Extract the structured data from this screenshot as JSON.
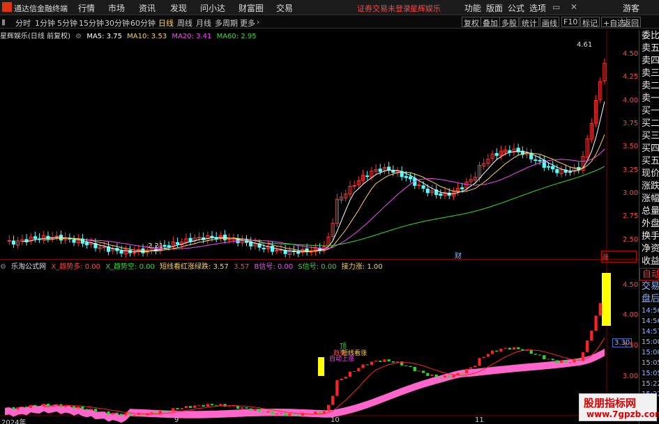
{
  "window": {
    "app_name": "通达信金融终端",
    "menus": [
      "行情",
      "市场",
      "资讯",
      "发现",
      "问小达",
      "财富圈",
      "交易"
    ],
    "notice": "证券交易未登录",
    "stock_title": "星辉娱乐",
    "right_menus": [
      "功能",
      "版面",
      "公式",
      "选项"
    ],
    "guest": "游客"
  },
  "toolbar": {
    "periods": [
      "分时",
      "1分钟",
      "5分钟",
      "15分钟",
      "30分钟",
      "60分钟",
      "日线",
      "周线",
      "月线",
      "多周期",
      "更多"
    ],
    "active_period": "日线",
    "right_buttons": [
      "复权",
      "叠加",
      "多股",
      "统计",
      "画线",
      "F10",
      "标记",
      "+自选",
      "返回"
    ]
  },
  "main_chart": {
    "stock_label": "星辉娱乐(日线 前复权)",
    "ma": [
      {
        "name": "MA5",
        "value": "3.75",
        "color": "#ffffff"
      },
      {
        "name": "MA10",
        "value": "3.53",
        "color": "#ffd34d"
      },
      {
        "name": "MA20",
        "value": "3.41",
        "color": "#ff44ff"
      },
      {
        "name": "MA60",
        "value": "2.95",
        "color": "#33dd33"
      }
    ],
    "price_ticks": [
      "4.50",
      "4.25",
      "4.00",
      "3.75",
      "3.50",
      "3.25",
      "3.00",
      "2.75",
      "2.50"
    ],
    "high_label": "4.61",
    "low_label": "2.21",
    "marks": [
      "财",
      "涨"
    ]
  },
  "indicator": {
    "label": "乐淘公式网",
    "items": [
      {
        "name": "X_趋势多",
        "value": "0.00",
        "color": "#ff4444"
      },
      {
        "name": "X_趋势空",
        "value": "0.00",
        "color": "#33dd33"
      },
      {
        "name": "短线看红涨绿跌",
        "value": "3.57",
        "color": "#ffd34d"
      },
      {
        "name": "",
        "value": "3.57",
        "color": "#ff4444"
      },
      {
        "name": "B信号",
        "value": "0.00",
        "color": "#ff44ff"
      },
      {
        "name": "S信号",
        "value": "0.00",
        "color": "#33dd33"
      },
      {
        "name": "接力涨",
        "value": "1.00",
        "color": "#ffd34d"
      }
    ],
    "price_ticks": [
      "4.50",
      "4.00",
      "3.50",
      "3.00"
    ],
    "current": "3.30",
    "annotations": [
      "顶",
      "趋势",
      "短线看涨",
      "自动上涨"
    ]
  },
  "right_panel": [
    "委比",
    "卖五",
    "卖四",
    "卖三",
    "卖二",
    "卖一",
    "买一",
    "买二",
    "买三",
    "买四",
    "买五",
    "现价",
    "涨跌",
    "涨幅",
    "总量",
    "外盘",
    "换手",
    "净资",
    "收益",
    "自动",
    "交易",
    "盘后",
    "14:56",
    "14:56",
    "14:57",
    "15:00",
    "15:00",
    "15:05",
    "15:05",
    "15:22",
    "15:22"
  ],
  "time_axis": [
    "2024年",
    "9",
    "10",
    "11"
  ],
  "watermark": {
    "line1": "股朋指标网",
    "line2": "www.7gpzb.com"
  },
  "colors": {
    "up": "#ff3232",
    "down": "#54ffff",
    "ma5": "#ffffff",
    "ma10": "#ffd34d",
    "ma20": "#ff44ff",
    "ma60": "#33dd33"
  }
}
